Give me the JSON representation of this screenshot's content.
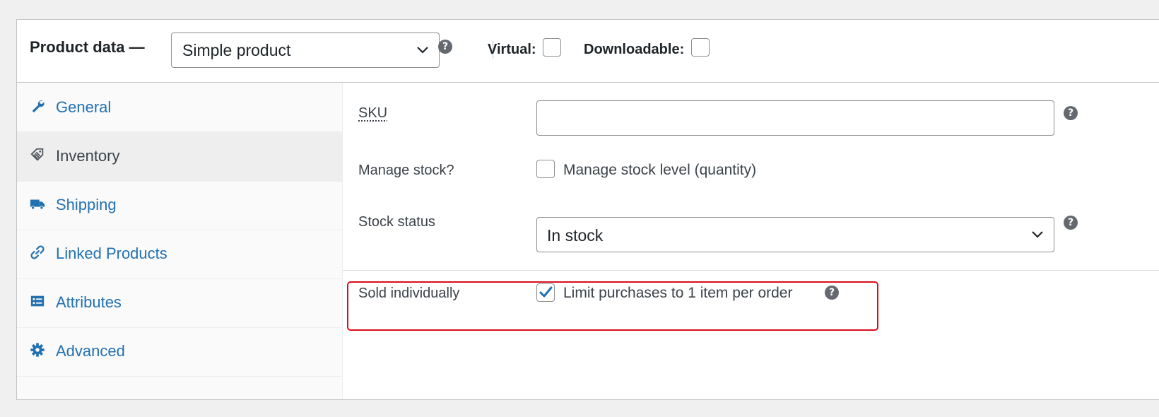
{
  "header": {
    "title": "Product data —",
    "product_type": "Simple product",
    "virtual_label": "Virtual:",
    "downloadable_label": "Downloadable:",
    "help_glyph": "?"
  },
  "sidebar": {
    "items": [
      {
        "label": "General",
        "icon": "wrench-icon",
        "active": false
      },
      {
        "label": "Inventory",
        "icon": "tag-icon",
        "active": true
      },
      {
        "label": "Shipping",
        "icon": "truck-icon",
        "active": false
      },
      {
        "label": "Linked Products",
        "icon": "link-icon",
        "active": false
      },
      {
        "label": "Attributes",
        "icon": "list-icon",
        "active": false
      },
      {
        "label": "Advanced",
        "icon": "gear-icon",
        "active": false
      }
    ]
  },
  "inventory": {
    "sku_label": "SKU",
    "sku_value": "",
    "manage_stock_label": "Manage stock?",
    "manage_stock_checkbox_label": "Manage stock level (quantity)",
    "manage_stock_checked": false,
    "stock_status_label": "Stock status",
    "stock_status_value": "In stock",
    "sold_individually_label": "Sold individually",
    "sold_individually_checkbox_label": "Limit purchases to 1 item per order",
    "sold_individually_checked": true
  },
  "colors": {
    "link": "#2271b1",
    "highlight_border": "#d80e1c",
    "help_icon_bg": "#646970"
  }
}
